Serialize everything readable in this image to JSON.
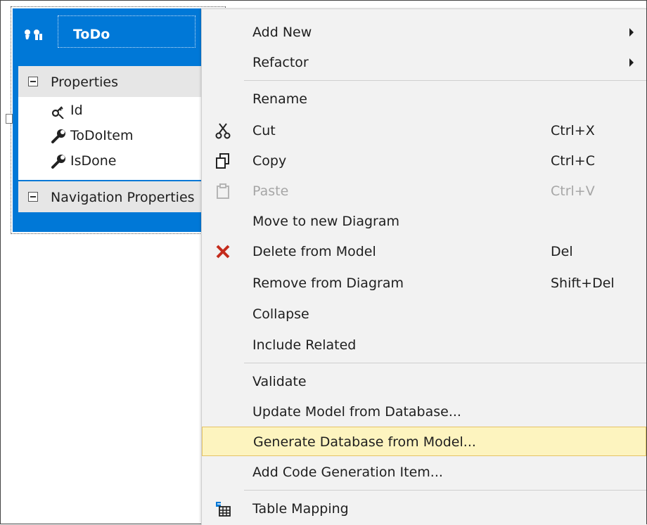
{
  "entity": {
    "title": "ToDo",
    "sections": {
      "properties": "Properties",
      "navigation": "Navigation Properties"
    },
    "properties": [
      {
        "name": "Id",
        "icon": "key-property-icon"
      },
      {
        "name": "ToDoItem",
        "icon": "wrench-property-icon"
      },
      {
        "name": "IsDone",
        "icon": "wrench-property-icon"
      }
    ]
  },
  "menu": {
    "add_new": "Add New",
    "refactor": "Refactor",
    "rename": "Rename",
    "cut": "Cut",
    "cut_shortcut": "Ctrl+X",
    "copy": "Copy",
    "copy_shortcut": "Ctrl+C",
    "paste": "Paste",
    "paste_shortcut": "Ctrl+V",
    "move_to_new_diagram": "Move to new Diagram",
    "delete_from_model": "Delete from Model",
    "delete_shortcut": "Del",
    "remove_from_diagram": "Remove from Diagram",
    "remove_shortcut": "Shift+Del",
    "collapse": "Collapse",
    "include_related": "Include Related",
    "validate": "Validate",
    "update_model": "Update Model from Database...",
    "generate_database": "Generate Database from Model...",
    "add_code_generation": "Add Code Generation Item...",
    "table_mapping": "Table Mapping"
  },
  "colors": {
    "entity_blue": "#0078d7",
    "menu_bg": "#f2f2f2",
    "highlight_bg": "#fdf4bf",
    "delete_red": "#c42b1c"
  }
}
